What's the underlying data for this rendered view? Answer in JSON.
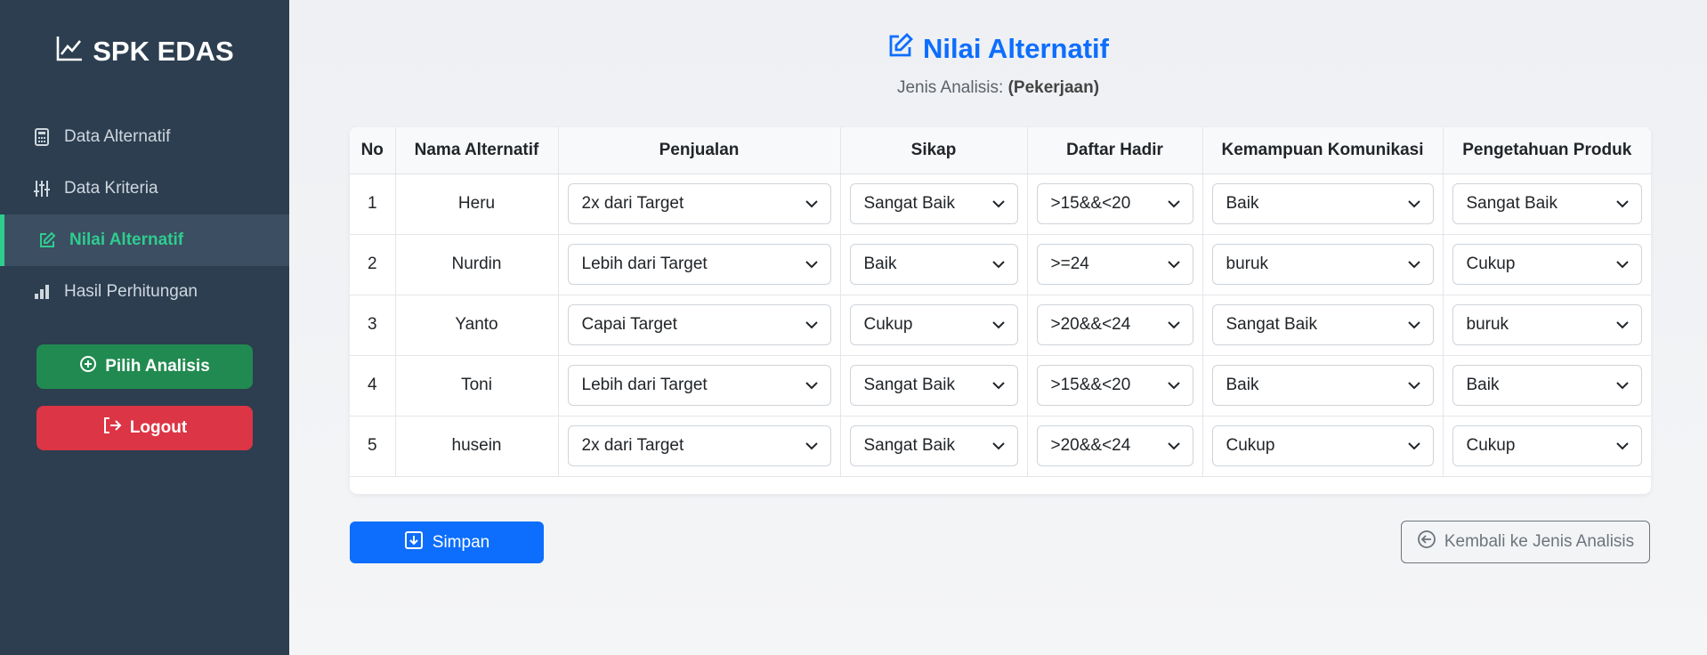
{
  "sidebar": {
    "brand": "SPK EDAS",
    "items": [
      {
        "label": "Data Alternatif",
        "icon": "calculator-icon"
      },
      {
        "label": "Data Kriteria",
        "icon": "sliders-icon"
      },
      {
        "label": "Nilai Alternatif",
        "icon": "edit-icon",
        "active": true
      },
      {
        "label": "Hasil Perhitungan",
        "icon": "bar-chart-icon"
      }
    ],
    "pilih_label": "Pilih Analisis",
    "logout_label": "Logout"
  },
  "page": {
    "title": "Nilai Alternatif",
    "subtitle_prefix": "Jenis Analisis:",
    "subtitle_value": "(Pekerjaan)"
  },
  "table": {
    "headers": [
      "No",
      "Nama Alternatif",
      "Penjualan",
      "Sikap",
      "Daftar Hadir",
      "Kemampuan Komunikasi",
      "Pengetahuan Produk"
    ],
    "rows": [
      {
        "no": "1",
        "nama": "Heru",
        "penjualan": "2x dari Target",
        "sikap": "Sangat Baik",
        "hadir": ">15&&<20",
        "komunikasi": "Baik",
        "produk": "Sangat Baik"
      },
      {
        "no": "2",
        "nama": "Nurdin",
        "penjualan": "Lebih dari Target",
        "sikap": "Baik",
        "hadir": ">=24",
        "komunikasi": "buruk",
        "produk": "Cukup"
      },
      {
        "no": "3",
        "nama": "Yanto",
        "penjualan": "Capai Target",
        "sikap": "Cukup",
        "hadir": ">20&&<24",
        "komunikasi": "Sangat Baik",
        "produk": "buruk"
      },
      {
        "no": "4",
        "nama": "Toni",
        "penjualan": "Lebih dari Target",
        "sikap": "Sangat Baik",
        "hadir": ">15&&<20",
        "komunikasi": "Baik",
        "produk": "Baik"
      },
      {
        "no": "5",
        "nama": "husein",
        "penjualan": "2x dari Target",
        "sikap": "Sangat Baik",
        "hadir": ">20&&<24",
        "komunikasi": "Cukup",
        "produk": "Cukup"
      }
    ]
  },
  "actions": {
    "save_label": "Simpan",
    "back_label": "Kembali ke Jenis Analisis"
  },
  "colors": {
    "sidebar_bg": "#2c3e50",
    "active_accent": "#2ecc8f",
    "primary": "#0d6efd",
    "success": "#218a50",
    "danger": "#dc3545"
  }
}
